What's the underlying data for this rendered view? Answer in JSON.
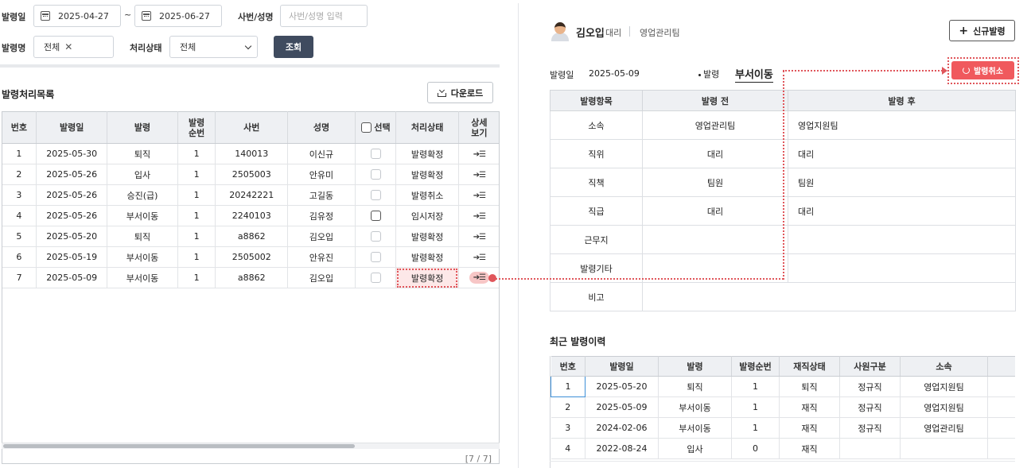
{
  "filters": {
    "date_label": "발령일",
    "date_from": "2025-04-27",
    "date_sep": "~",
    "date_to": "2025-06-27",
    "emp_label": "사번/성명",
    "emp_placeholder": "사번/성명 입력",
    "move_label": "발령명",
    "move_tag": "전체",
    "status_label": "처리상태",
    "status_value": "전체",
    "search_button": "조회"
  },
  "list": {
    "title": "발령처리목록",
    "download_button": "다운로드",
    "columns": [
      "번호",
      "발령일",
      "발령",
      "발령\n순번",
      "사번",
      "성명",
      "선택",
      "처리상태",
      "상세\n보기"
    ],
    "rows": [
      {
        "no": "1",
        "date": "2025-05-30",
        "type": "퇴직",
        "seq": "1",
        "emp_no": "140013",
        "name": "이신규",
        "status": "발령확정",
        "status_color": "#2277cc",
        "detail": "➔☰"
      },
      {
        "no": "2",
        "date": "2025-05-26",
        "type": "입사",
        "seq": "1",
        "emp_no": "2505003",
        "name": "안유미",
        "status": "발령확정",
        "status_color": "#2277cc",
        "detail": "➔☰"
      },
      {
        "no": "3",
        "date": "2025-05-26",
        "type": "승진(급)",
        "seq": "1",
        "emp_no": "20242221",
        "name": "고길동",
        "status": "발령취소",
        "status_color": "#e03e3e",
        "detail": "➔☰"
      },
      {
        "no": "4",
        "date": "2025-05-26",
        "type": "부서이동",
        "seq": "1",
        "emp_no": "2240103",
        "name": "김유정",
        "status": "임시저장",
        "status_color": "#222222",
        "detail": "➔☰"
      },
      {
        "no": "5",
        "date": "2025-05-20",
        "type": "퇴직",
        "seq": "1",
        "emp_no": "a8862",
        "name": "김오입",
        "status": "발령확정",
        "status_color": "#2277cc",
        "detail": "➔☰"
      },
      {
        "no": "6",
        "date": "2025-05-19",
        "type": "부서이동",
        "seq": "1",
        "emp_no": "2505002",
        "name": "안유진",
        "status": "발령확정",
        "status_color": "#2277cc",
        "detail": "➔☰"
      },
      {
        "no": "7",
        "date": "2025-05-09",
        "type": "부서이동",
        "seq": "1",
        "emp_no": "a8862",
        "name": "김오입",
        "status": "발령확정",
        "status_color": "#2277cc",
        "detail": "➔☰"
      }
    ],
    "pager": "[7 / 7]"
  },
  "detail": {
    "name": "김오입",
    "rank": "대리",
    "dept": "영업관리팀",
    "new_button": "신규발령",
    "date_label": "발령일",
    "date_value": "2025-05-09",
    "move_label": "발령",
    "move_value": "부서이동",
    "cancel_button": "발령취소",
    "columns": [
      "발령항목",
      "발령 전",
      "발령 후"
    ],
    "rows": [
      {
        "item": "소속",
        "before": "영업관리팀",
        "after": "영업지원팀"
      },
      {
        "item": "직위",
        "before": "대리",
        "after": "대리"
      },
      {
        "item": "직책",
        "before": "팀원",
        "after": "팀원"
      },
      {
        "item": "직급",
        "before": "대리",
        "after": "대리"
      },
      {
        "item": "근무지",
        "before": "",
        "after": ""
      },
      {
        "item": "발령기타",
        "before": "",
        "after": ""
      },
      {
        "item": "비고",
        "before": "",
        "after": ""
      }
    ]
  },
  "history": {
    "title": "최근 발령이력",
    "columns": [
      "번호",
      "발령일",
      "발령",
      "발령순번",
      "재직상태",
      "사원구분",
      "소속"
    ],
    "rows": [
      {
        "no": "1",
        "date": "2025-05-20",
        "type": "퇴직",
        "seq": "1",
        "state": "퇴직",
        "kind": "정규직",
        "dept": "영업지원팀"
      },
      {
        "no": "2",
        "date": "2025-05-09",
        "type": "부서이동",
        "seq": "1",
        "state": "재직",
        "kind": "정규직",
        "dept": "영업지원팀"
      },
      {
        "no": "3",
        "date": "2024-02-06",
        "type": "부서이동",
        "seq": "1",
        "state": "재직",
        "kind": "정규직",
        "dept": "영업관리팀"
      },
      {
        "no": "4",
        "date": "2022-08-24",
        "type": "입사",
        "seq": "0",
        "state": "재직",
        "kind": "",
        "dept": ""
      }
    ]
  },
  "colors": {
    "accent_red": "#f0595d",
    "link_blue": "#2277cc",
    "header_bg": "#eef0f3",
    "dark_button": "#3f4b5f"
  }
}
